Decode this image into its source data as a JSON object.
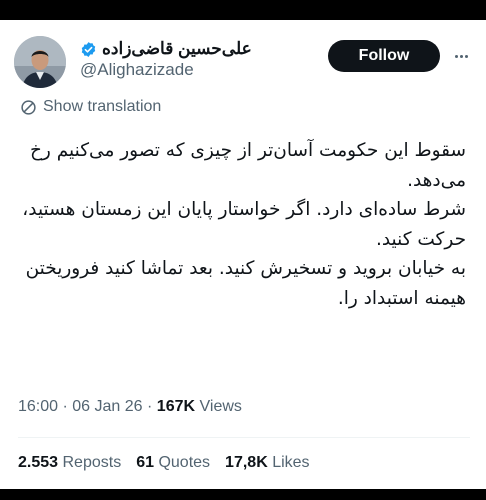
{
  "author": {
    "display_name": "علی‌حسین قاضی‌زاده",
    "handle": "@Alighazizade",
    "verified": true,
    "avatar_icon": "profile-photo"
  },
  "actions": {
    "follow_label": "Follow",
    "more_icon": "more-horizontal-icon"
  },
  "translation": {
    "label": "Show translation",
    "icon": "translate-icon"
  },
  "tweet": {
    "paragraphs": [
      "سقوط این حکومت آسان‌تر از چیزی که تصور می‌کنیم رخ می‌دهد.",
      "شرط ساده‌ای دارد. اگر خواستار پایان این زمستان هستید، حرکت کنید.",
      "به خیابان بروید و تسخیرش کنید. بعد تماشا کنید فروریختن هیمنه استبداد را."
    ]
  },
  "meta": {
    "time": "16:00",
    "separator": "·",
    "date": "06 Jan 26",
    "views_count": "167K",
    "views_label": "Views"
  },
  "stats": {
    "reposts_count": "2.553",
    "reposts_label": "Reposts",
    "quotes_count": "61",
    "quotes_label": "Quotes",
    "likes_count": "17,8K",
    "likes_label": "Likes"
  },
  "colors": {
    "text": "#0f1419",
    "secondary": "#536471",
    "verified_blue": "#1d9bf0",
    "button_bg": "#0f1419"
  }
}
